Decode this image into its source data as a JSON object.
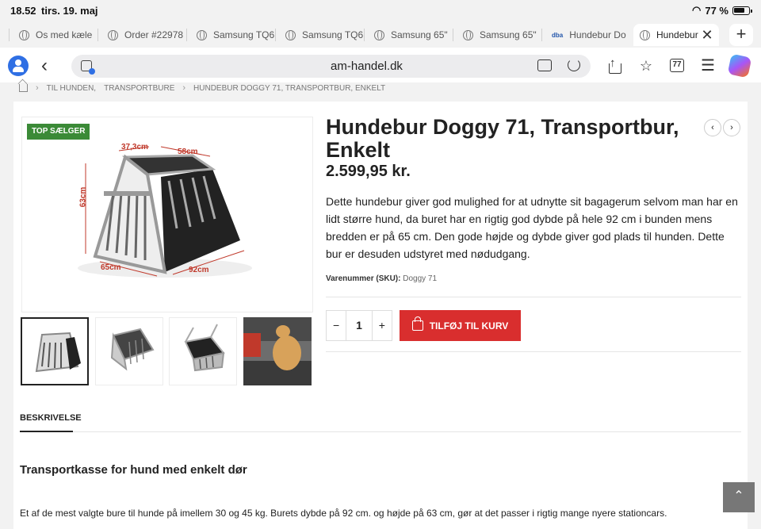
{
  "status": {
    "time": "18.52",
    "date": "tirs. 19. maj",
    "battery": "77 %",
    "battery_level": 0.77
  },
  "tabs": [
    {
      "label": "Os med kæle"
    },
    {
      "label": "Order #22978"
    },
    {
      "label": "Samsung TQ6"
    },
    {
      "label": "Samsung TQ6"
    },
    {
      "label": "Samsung 65\""
    },
    {
      "label": "Samsung 65\""
    },
    {
      "label": "Hundebur Do"
    },
    {
      "label": "Hundebur"
    }
  ],
  "toolbar": {
    "url": "am-handel.dk",
    "tab_count": "77"
  },
  "breadcrumb": {
    "items": [
      "TIL HUNDEN,",
      "TRANSPORTBURE",
      "HUNDEBUR DOGGY 71, TRANSPORTBUR, ENKELT"
    ]
  },
  "product": {
    "badge": "TOP SÆLGER",
    "title": "Hundebur Doggy 71, Transportbur, Enkelt",
    "price": "2.599,95 kr.",
    "description": "Dette hundebur giver god mulighed for at udnytte sit bagagerum selvom man har en lidt større hund, da buret har en rigtig god dybde på hele 92 cm i bunden mens bredden er på 65 cm. Den gode højde og dybde giver god plads til hunden. Dette bur er desuden udstyret med nødudgang.",
    "sku_label": "Varenummer (SKU):",
    "sku_value": "Doggy 71",
    "quantity": "1",
    "add_to_cart": "TILFØJ TIL KURV",
    "dims": {
      "top_front": "37,3cm",
      "top_side": "58cm",
      "height": "63cm",
      "bottom_front": "65cm",
      "bottom_side": "92cm"
    }
  },
  "details": {
    "tab_label": "BESKRIVELSE",
    "heading": "Transportkasse for hund med enkelt dør",
    "text": "Et af de mest valgte bure til hunde på imellem 30 og 45 kg. Burets dybde på 92 cm. og højde på 63 cm, gør at det passer i rigtig mange nyere stationcars."
  },
  "colors": {
    "accent": "#d92e2e",
    "badge": "#3b8a37",
    "profile": "#2f6fe4"
  }
}
